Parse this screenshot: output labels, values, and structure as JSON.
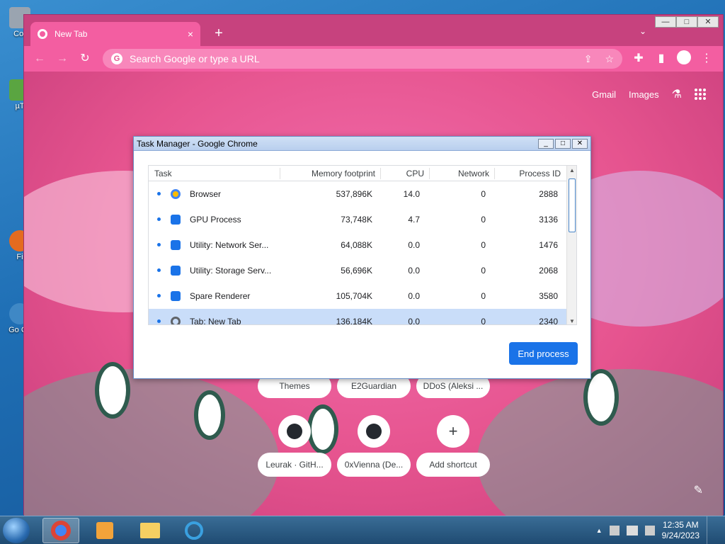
{
  "desktop": {
    "icons": [
      {
        "label": "Cor",
        "color": "#9aa4b0"
      },
      {
        "label": "µT",
        "color": "#5aa541"
      },
      {
        "label": "Fi",
        "color": "#e46b1f"
      },
      {
        "label": "Go Ch",
        "color": "#3f88c5"
      }
    ]
  },
  "chrome": {
    "tab": {
      "title": "New Tab",
      "close": "×"
    },
    "new_tab": "+",
    "tab_search": "⌄",
    "window_controls": {
      "minimize": "—",
      "maximize": "□",
      "close": "✕"
    },
    "toolbar": {
      "back": "←",
      "forward": "→",
      "reload": "↻",
      "omnibox_placeholder": "Search Google or type a URL",
      "share": "⇪",
      "bookmark": "☆",
      "extensions": "✚",
      "sidepanel": "▮",
      "menu": "⋮"
    },
    "ntp": {
      "gmail": "Gmail",
      "images": "Images",
      "shortcuts_row1": [
        "Themes",
        "E2Guardian",
        "DDoS (Aleksi ..."
      ],
      "shortcuts_row2": [
        "Leurak · GitH...",
        "0xVienna (De...",
        "Add shortcut"
      ],
      "add_icon": "+",
      "edit_icon": "✎"
    }
  },
  "task_manager": {
    "title": "Task Manager - Google Chrome",
    "columns": [
      "Task",
      "Memory footprint",
      "CPU",
      "Network",
      "Process ID"
    ],
    "rows": [
      {
        "task": "Browser",
        "memory": "537,896K",
        "cpu": "14.0",
        "network": "0",
        "pid": "2888",
        "icon": "chrome"
      },
      {
        "task": "GPU Process",
        "memory": "73,748K",
        "cpu": "4.7",
        "network": "0",
        "pid": "3136",
        "icon": "puzzle"
      },
      {
        "task": "Utility: Network Ser...",
        "memory": "64,088K",
        "cpu": "0.0",
        "network": "0",
        "pid": "1476",
        "icon": "puzzle"
      },
      {
        "task": "Utility: Storage Serv...",
        "memory": "56,696K",
        "cpu": "0.0",
        "network": "0",
        "pid": "2068",
        "icon": "puzzle"
      },
      {
        "task": "Spare Renderer",
        "memory": "105,704K",
        "cpu": "0.0",
        "network": "0",
        "pid": "3580",
        "icon": "puzzle"
      },
      {
        "task": "Tab: New Tab",
        "memory": "136,184K",
        "cpu": "0.0",
        "network": "0",
        "pid": "2340",
        "icon": "chrome-gray"
      }
    ],
    "end_process": "End process"
  },
  "taskbar": {
    "time": "12:35 AM",
    "date": "9/24/2023",
    "tray_arrow": "▲"
  },
  "colors": {
    "chrome_frame": "#c7427e",
    "chrome_toolbar": "#f35ea1",
    "accent_blue": "#1a73e8",
    "row_selected": "#c9ddf9"
  }
}
